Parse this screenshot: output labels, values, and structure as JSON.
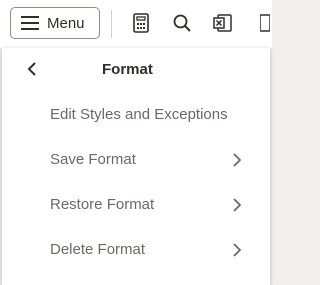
{
  "toolbar": {
    "menu_label": "Menu",
    "icons": [
      "calculator-icon",
      "search-icon",
      "excel-icon"
    ]
  },
  "panel": {
    "title": "Format",
    "items": [
      {
        "label": "Edit Styles and Exceptions",
        "has_submenu": false
      },
      {
        "label": "Save Format",
        "has_submenu": true
      },
      {
        "label": "Restore Format",
        "has_submenu": true
      },
      {
        "label": "Delete Format",
        "has_submenu": true
      }
    ]
  },
  "colors": {
    "background": "#f1efed",
    "panel": "#ffffff",
    "text_primary": "#312d2a",
    "text_secondary": "#6d6863",
    "border": "#8f8b86"
  }
}
